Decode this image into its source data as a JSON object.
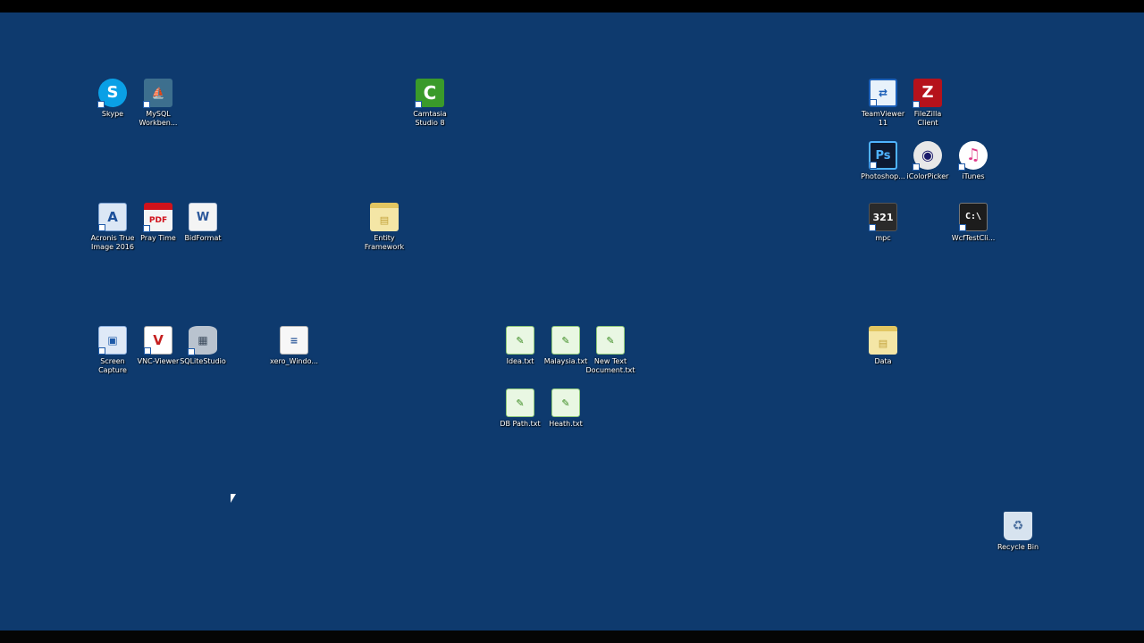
{
  "desktop": {
    "icons": [
      {
        "id": "skype",
        "label": "Skype",
        "symbol": "S",
        "icon": "skype-icon"
      },
      {
        "id": "mysql",
        "label": "MySQL Workben...",
        "symbol": "⛵",
        "icon": "mysql-workbench-icon"
      },
      {
        "id": "camtasia",
        "label": "Camtasia Studio 8",
        "symbol": "C",
        "icon": "camtasia-icon"
      },
      {
        "id": "teamviewer",
        "label": "TeamViewer 11",
        "symbol": "⇄",
        "icon": "teamviewer-icon"
      },
      {
        "id": "filezilla",
        "label": "FileZilla Client",
        "symbol": "Z",
        "icon": "filezilla-icon"
      },
      {
        "id": "photoshop",
        "label": "Photoshop...",
        "symbol": "Ps",
        "icon": "photoshop-icon"
      },
      {
        "id": "icolorpicker",
        "label": "iColorPicker",
        "symbol": "◉",
        "icon": "eye-icon"
      },
      {
        "id": "itunes",
        "label": "iTunes",
        "symbol": "♫",
        "icon": "itunes-icon"
      },
      {
        "id": "acronis",
        "label": "Acronis True Image 2016",
        "symbol": "A",
        "icon": "acronis-icon"
      },
      {
        "id": "praytime",
        "label": "Pray Time",
        "symbol": "PDF",
        "icon": "pdf-icon"
      },
      {
        "id": "bidformat",
        "label": "BidFormat",
        "symbol": "W",
        "icon": "word-document-icon"
      },
      {
        "id": "entity",
        "label": "Entity Framework",
        "symbol": "▤",
        "icon": "folder-icon"
      },
      {
        "id": "mpc",
        "label": "mpc",
        "symbol": "321",
        "icon": "media-player-classic-icon"
      },
      {
        "id": "wcftest",
        "label": "WcfTestCli...",
        "symbol": "C:\\",
        "icon": "console-icon"
      },
      {
        "id": "screencapture",
        "label": "Screen Capture",
        "symbol": "▣",
        "icon": "screen-capture-icon"
      },
      {
        "id": "vnc",
        "label": "VNC-Viewer",
        "symbol": "V",
        "icon": "vnc-viewer-icon"
      },
      {
        "id": "sqlite",
        "label": "SQLiteStudio",
        "symbol": "▦",
        "icon": "database-icon"
      },
      {
        "id": "xero",
        "label": "xero_Windo...",
        "symbol": "≡",
        "icon": "web-document-icon"
      },
      {
        "id": "idea",
        "label": "Idea.txt",
        "symbol": "✎",
        "icon": "text-file-icon"
      },
      {
        "id": "malaysia",
        "label": "Malaysia.txt",
        "symbol": "✎",
        "icon": "text-file-icon"
      },
      {
        "id": "newtext",
        "label": "New Text Document.txt",
        "symbol": "✎",
        "icon": "text-file-icon"
      },
      {
        "id": "dbpath",
        "label": "DB Path.txt",
        "symbol": "✎",
        "icon": "text-file-icon"
      },
      {
        "id": "heath",
        "label": "Heath.txt",
        "symbol": "✎",
        "icon": "text-file-icon"
      },
      {
        "id": "data",
        "label": "Data",
        "symbol": "▤",
        "icon": "folder-icon"
      },
      {
        "id": "recyclebin",
        "label": "Recycle Bin",
        "symbol": "♻",
        "icon": "recycle-bin-icon"
      }
    ]
  }
}
